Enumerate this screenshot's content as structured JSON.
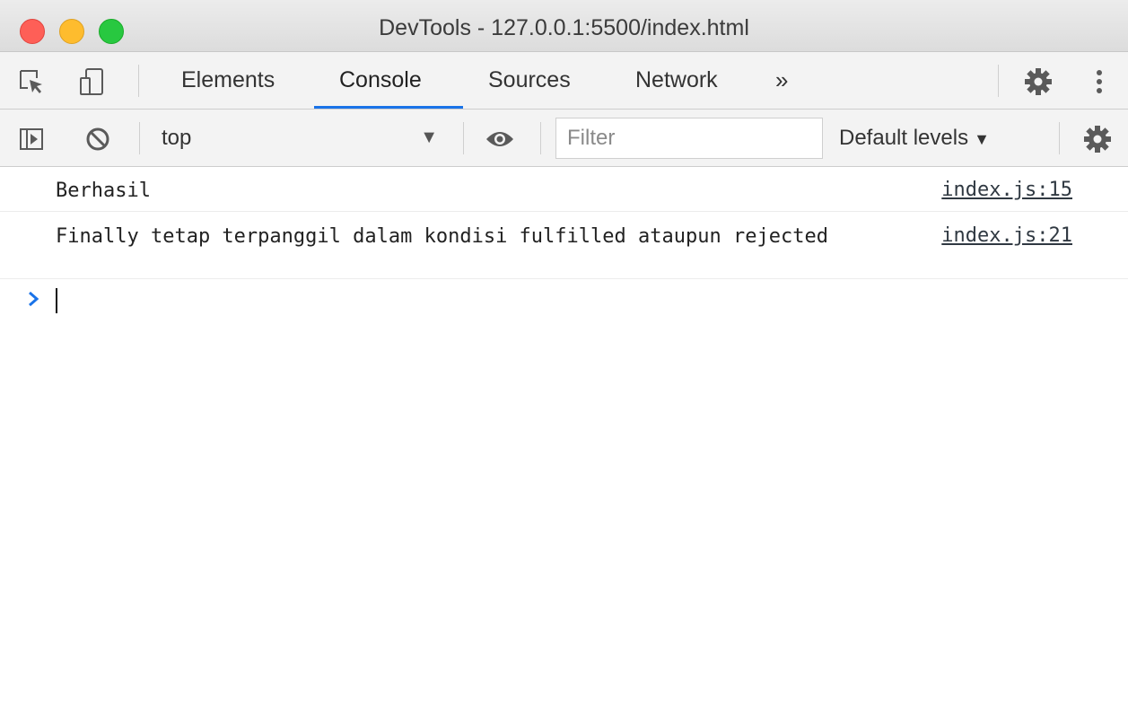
{
  "window": {
    "title": "DevTools - 127.0.0.1:5500/index.html",
    "traffic_lights": [
      "close",
      "minimize",
      "maximize"
    ]
  },
  "toolbar": {
    "icons": [
      "inspect-element-icon",
      "device-toolbar-icon",
      "gear-icon",
      "more-vertical-icon"
    ],
    "tabs": [
      {
        "label": "Elements",
        "active": false
      },
      {
        "label": "Console",
        "active": true
      },
      {
        "label": "Sources",
        "active": false
      },
      {
        "label": "Network",
        "active": false
      }
    ],
    "more_tabs_label": "»",
    "accent_color": "#1a73e8"
  },
  "console_toolbar": {
    "icons": [
      "sidebar-toggle-icon",
      "clear-console-icon",
      "eye-icon",
      "gear-icon"
    ],
    "context": "top",
    "context_arrow": "▼",
    "filter_placeholder": "Filter",
    "filter_value": "",
    "levels_label": "Default levels",
    "levels_arrow": "▼"
  },
  "console": {
    "messages": [
      {
        "text": "Berhasil",
        "source": "index.js:15"
      },
      {
        "text": "Finally tetap terpanggil dalam kondisi fulfilled ataupun rejected",
        "source": "index.js:21"
      }
    ],
    "prompt_symbol": "›",
    "prompt_color": "#1a73e8",
    "input_value": ""
  }
}
